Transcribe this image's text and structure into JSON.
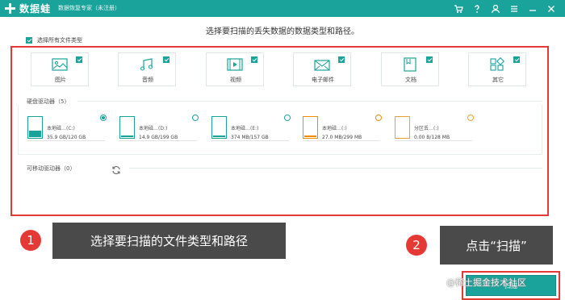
{
  "app": {
    "logo_text": "数据蛙",
    "subtitle": "数据恢复专家（未注册）",
    "colors": {
      "accent": "#1aa39a",
      "highlight": "#e53935",
      "callout_bg": "#4a4a4a"
    }
  },
  "titlebar_icons": [
    "cart-icon",
    "help-icon",
    "user-icon",
    "menu-icon",
    "minimize-icon",
    "close-icon"
  ],
  "heading": "选择要扫描的丢失数据的数据类型和路径。",
  "select_all": {
    "label": "选择所有文件类型",
    "checked": true
  },
  "file_types": [
    {
      "label": "图片",
      "icon": "image-icon",
      "checked": true
    },
    {
      "label": "音频",
      "icon": "audio-icon",
      "checked": true
    },
    {
      "label": "视频",
      "icon": "video-icon",
      "checked": true
    },
    {
      "label": "电子邮件",
      "icon": "email-icon",
      "checked": true
    },
    {
      "label": "文档",
      "icon": "document-icon",
      "checked": true
    },
    {
      "label": "其它",
      "icon": "other-icon",
      "checked": true
    }
  ],
  "hard_drives": {
    "title": "硬盘驱动器（5）",
    "items": [
      {
        "name": "本地磁…(C:)",
        "size": "35.9 GB/120 GB",
        "used": 0.3,
        "color": "#1aa39a",
        "selected": true
      },
      {
        "name": "本地磁…(D:)",
        "size": "14.9 GB/199 GB",
        "used": 0.075,
        "color": "#1aa39a",
        "selected": false
      },
      {
        "name": "本地磁…(E:)",
        "size": "374 MB/157 GB",
        "used": 0.02,
        "color": "#1aa39a",
        "selected": false
      },
      {
        "name": "本地磁…(:)",
        "size": "27.0 MB/299 MB",
        "used": 0.09,
        "color": "#f08a00",
        "selected": false
      },
      {
        "name": "分区丢…(:)",
        "size": "0.00  B/128 MB",
        "used": 0.0,
        "color": "#f0a030",
        "selected": false
      }
    ]
  },
  "removable": {
    "title": "可移动驱动器（0）"
  },
  "callouts": [
    {
      "number": "1",
      "text": "选择要扫描的文件类型和路径"
    },
    {
      "number": "2",
      "text": "点击“扫描”"
    }
  ],
  "scan_button": {
    "label": "扫描"
  },
  "watermark": "@稀土掘金技术社区"
}
